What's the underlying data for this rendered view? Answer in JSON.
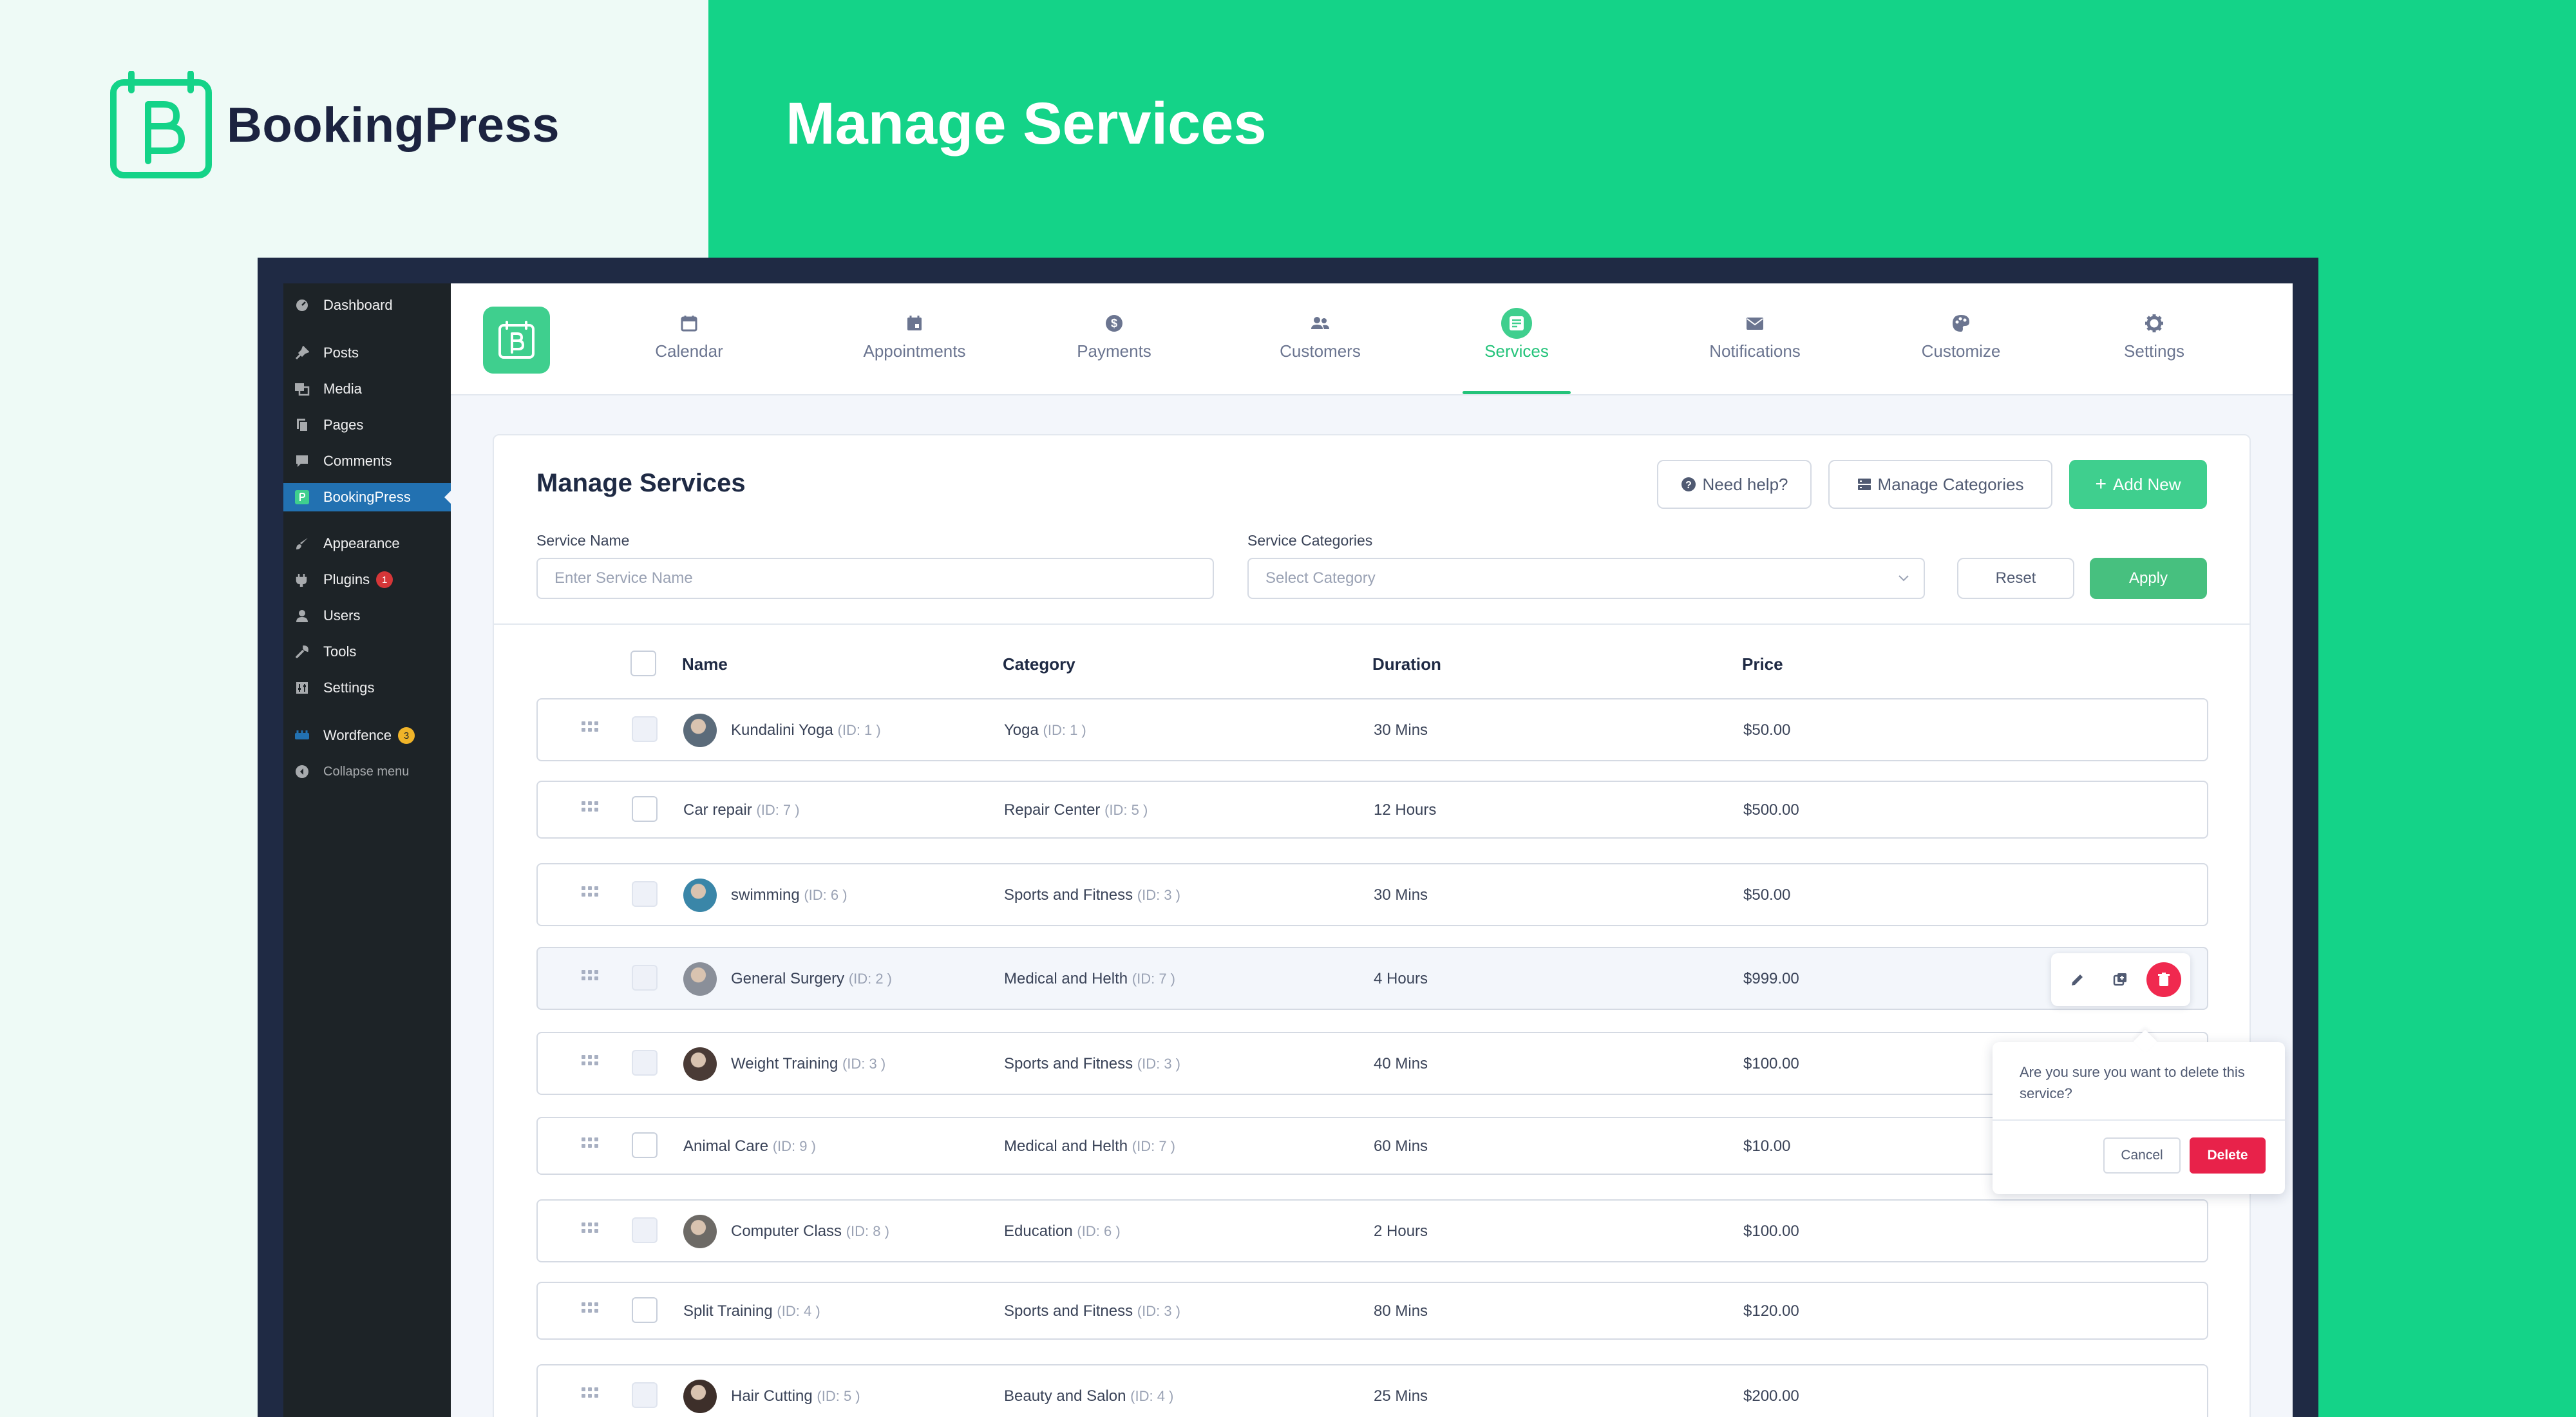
{
  "brand": {
    "name": "BookingPress"
  },
  "hero": {
    "title": "Manage Services"
  },
  "colors": {
    "brand_green": "#14d388",
    "accent": "#3fcf8e",
    "danger": "#e8224a",
    "wp_sidebar": "#1d2327",
    "wp_active": "#2271b1"
  },
  "wp_menu": {
    "items": [
      {
        "label": "Dashboard",
        "icon": "dashboard-icon"
      },
      {
        "label": "Posts",
        "icon": "pin-icon"
      },
      {
        "label": "Media",
        "icon": "media-icon"
      },
      {
        "label": "Pages",
        "icon": "pages-icon"
      },
      {
        "label": "Comments",
        "icon": "comment-icon"
      },
      {
        "label": "BookingPress",
        "icon": "bookingpress-icon"
      },
      {
        "label": "Appearance",
        "icon": "brush-icon"
      },
      {
        "label": "Plugins",
        "icon": "plugin-icon",
        "badge": "1"
      },
      {
        "label": "Users",
        "icon": "user-icon"
      },
      {
        "label": "Tools",
        "icon": "wrench-icon"
      },
      {
        "label": "Settings",
        "icon": "settings-icon"
      },
      {
        "label": "Wordfence",
        "icon": "wordfence-icon",
        "badge": "3"
      },
      {
        "label": "Collapse menu",
        "icon": "collapse-icon"
      }
    ]
  },
  "nav": {
    "tabs": [
      {
        "label": "Calendar",
        "icon": "calendar-icon"
      },
      {
        "label": "Appointments",
        "icon": "appointment-icon"
      },
      {
        "label": "Payments",
        "icon": "dollar-icon"
      },
      {
        "label": "Customers",
        "icon": "customers-icon"
      },
      {
        "label": "Services",
        "icon": "services-icon",
        "active": true
      },
      {
        "label": "Notifications",
        "icon": "mail-icon"
      },
      {
        "label": "Customize",
        "icon": "palette-icon"
      },
      {
        "label": "Settings",
        "icon": "gear-icon"
      }
    ]
  },
  "page": {
    "title": "Manage Services",
    "help_label": "Need help?",
    "categories_label": "Manage Categories",
    "add_label": "Add New"
  },
  "filters": {
    "name_label": "Service Name",
    "name_placeholder": "Enter Service Name",
    "category_label": "Service Categories",
    "category_placeholder": "Select Category",
    "reset_label": "Reset",
    "apply_label": "Apply"
  },
  "table": {
    "columns": [
      "Name",
      "Category",
      "Duration",
      "Price"
    ],
    "rows": [
      {
        "name": "Kundalini Yoga",
        "id": "(ID: 1 )",
        "category": "Yoga",
        "cat_id": "(ID: 1 )",
        "duration": "30 Mins",
        "price": "$50.00",
        "avatar": true
      },
      {
        "name": "Car repair",
        "id": "(ID: 7 )",
        "category": "Repair Center",
        "cat_id": "(ID: 5 )",
        "duration": "12 Hours",
        "price": "$500.00",
        "avatar": false
      },
      {
        "name": "swimming",
        "id": "(ID: 6 )",
        "category": "Sports and Fitness",
        "cat_id": "(ID: 3 )",
        "duration": "30 Mins",
        "price": "$50.00",
        "avatar": true
      },
      {
        "name": "General Surgery",
        "id": "(ID: 2 )",
        "category": "Medical and Helth",
        "cat_id": "(ID: 7 )",
        "duration": "4 Hours",
        "price": "$999.00",
        "avatar": true
      },
      {
        "name": "Weight Training",
        "id": "(ID: 3 )",
        "category": "Sports and Fitness",
        "cat_id": "(ID: 3 )",
        "duration": "40 Mins",
        "price": "$100.00",
        "avatar": true
      },
      {
        "name": "Animal Care",
        "id": "(ID: 9 )",
        "category": "Medical and Helth",
        "cat_id": "(ID: 7 )",
        "duration": "60 Mins",
        "price": "$10.00",
        "avatar": false
      },
      {
        "name": "Computer Class",
        "id": "(ID: 8 )",
        "category": "Education",
        "cat_id": "(ID: 6 )",
        "duration": "2 Hours",
        "price": "$100.00",
        "avatar": true
      },
      {
        "name": "Split Training",
        "id": "(ID: 4 )",
        "category": "Sports and Fitness",
        "cat_id": "(ID: 3 )",
        "duration": "80 Mins",
        "price": "$120.00",
        "avatar": false
      },
      {
        "name": "Hair Cutting",
        "id": "(ID: 5 )",
        "category": "Beauty and Salon",
        "cat_id": "(ID: 4 )",
        "duration": "25 Mins",
        "price": "$200.00",
        "avatar": true
      }
    ]
  },
  "row_actions": {
    "icons": [
      "edit-icon",
      "duplicate-icon",
      "trash-icon"
    ]
  },
  "confirm": {
    "message": "Are you sure you want to delete this service?",
    "cancel_label": "Cancel",
    "delete_label": "Delete"
  }
}
